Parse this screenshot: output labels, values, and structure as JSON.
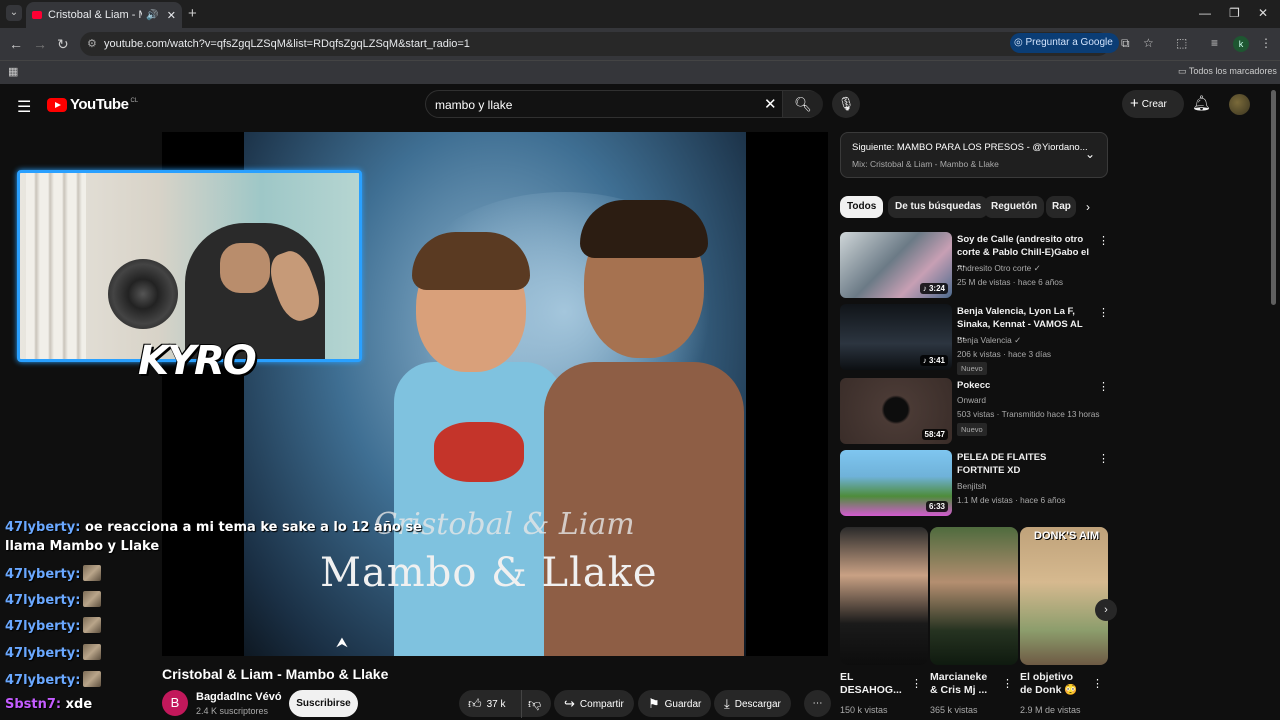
{
  "browser": {
    "tab_title": "Cristobal & Liam - Mambo",
    "url": "youtube.com/watch?v=qfsZgqLZSqM&list=RDqfsZgqLZSqM&start_radio=1",
    "ask_google": "Preguntar a Google",
    "bookmarks_all": "Todos los marcadores",
    "profile_initial": "k"
  },
  "header": {
    "logo_text": "YouTube",
    "country": "CL",
    "search_value": "mambo y llake",
    "create_label": "Crear"
  },
  "overlay": {
    "streamer_logo": "KYRO",
    "chat": [
      {
        "user": "47lyberty:",
        "msg": "oe reacciona a mi tema ke sake a lo 12 año se llama Mambo y Llake"
      },
      {
        "user": "47lyberty:",
        "msg": ""
      },
      {
        "user": "47lyberty:",
        "msg": ""
      },
      {
        "user": "47lyberty:",
        "msg": ""
      },
      {
        "user": "47lyberty:",
        "msg": ""
      },
      {
        "user": "47lyberty:",
        "msg": ""
      },
      {
        "user": "Sbstn7:",
        "msg": "xde"
      }
    ],
    "video_text_line1": "Cristobal & Liam",
    "video_text_line2": "Mambo & Llake"
  },
  "video": {
    "title": "Cristobal & Liam - Mambo & Llake",
    "channel_initial": "B",
    "channel_name": "BagdadInc Vévó",
    "subscribers": "2.4 K suscriptores",
    "subscribe_label": "Suscribirse",
    "likes": "37 k",
    "share_label": "Compartir",
    "save_label": "Guardar",
    "download_label": "Descargar"
  },
  "sidebar": {
    "next_title": "Siguiente: MAMBO PARA LOS PRESOS - @Yiordano...",
    "next_sub": "Mix: Cristobal & Liam - Mambo & Llake",
    "chips": [
      "Todos",
      "De tus búsquedas",
      "Reguetón",
      "Rap"
    ],
    "recs": [
      {
        "title": "Soy de Calle (andresito otro corte & Pablo Chill-E)Gabo el ...",
        "channel": "Andresito Otro corte",
        "meta": "25 M de vistas · hace 6 años",
        "duration": "3:24",
        "badge": ""
      },
      {
        "title": "Benja Valencia, Lyon La F, Sinaka, Kennat - VAMOS AL ...",
        "channel": "Benja Valencia",
        "meta": "206 k vistas · hace 3 días",
        "duration": "3:41",
        "badge": "Nuevo"
      },
      {
        "title": "Pokecc",
        "channel": "Onward",
        "meta": "503 vistas · Transmitido hace 13 horas",
        "duration": "58:47",
        "badge": "Nuevo"
      },
      {
        "title": "PELEA DE FLAITES FORTNITE XD",
        "channel": "Benjitsh",
        "meta": "1.1 M de vistas · hace 6 años",
        "duration": "6:33",
        "badge": ""
      }
    ],
    "shorts": [
      {
        "title": "EL DESAHOG...",
        "views": "150 k vistas"
      },
      {
        "title": "Marcianeke & Cris Mj ...",
        "views": "365 k vistas"
      },
      {
        "title": "El objetivo de Donk 😳",
        "views": "2.9 M de vistas"
      }
    ],
    "short3_overlay": "DONK'S AIM"
  },
  "colors": {
    "accent": "#ff0000",
    "cam_border": "#29a0ff",
    "chat_user": "#6aa8ff",
    "chat_user_alt": "#c45cff"
  }
}
